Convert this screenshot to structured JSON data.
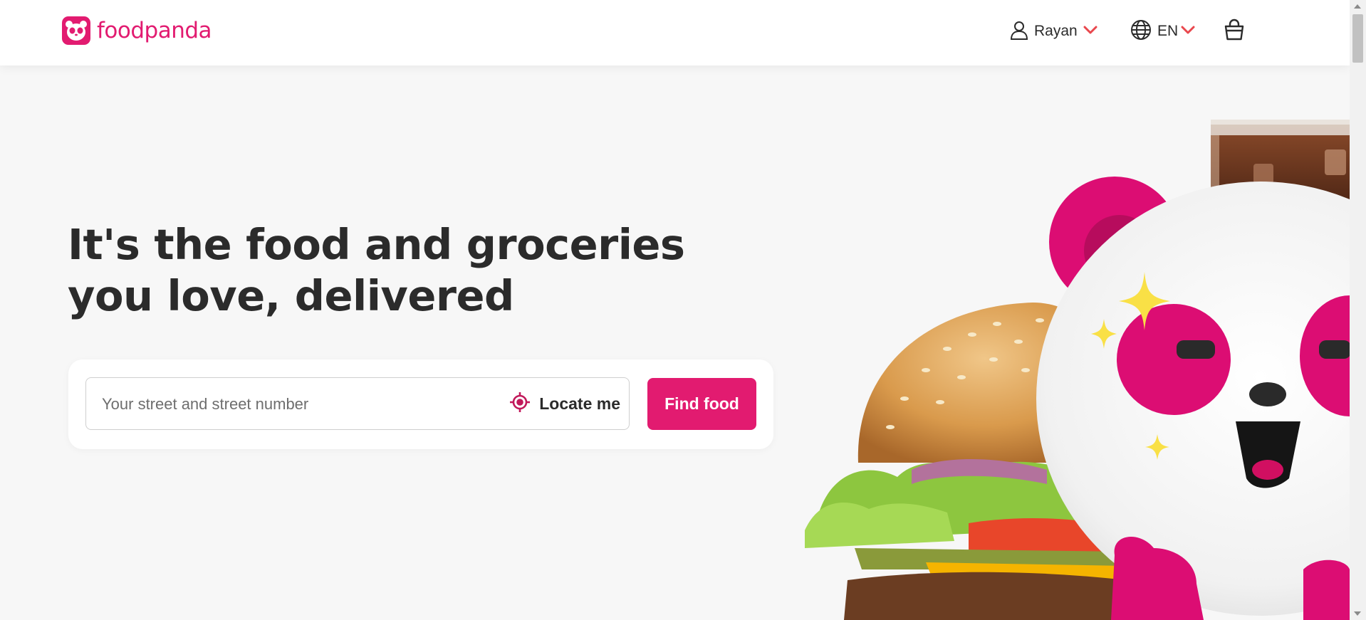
{
  "header": {
    "brand": "foodpanda",
    "user_name": "Rayan",
    "language": "EN"
  },
  "hero": {
    "headline": "It's the food and groceries you love, delivered"
  },
  "search": {
    "placeholder": "Your street and street number",
    "value": "",
    "locate_label": "Locate me",
    "submit_label": "Find food"
  },
  "colors": {
    "brand": "#e21b70",
    "chevron": "#e9474d",
    "text": "#2b2b2b",
    "background": "#f7f7f7"
  },
  "icons": [
    "panda-logo-icon",
    "user-icon",
    "chevron-down-icon",
    "globe-icon",
    "cart-icon",
    "locate-crosshair-icon"
  ]
}
